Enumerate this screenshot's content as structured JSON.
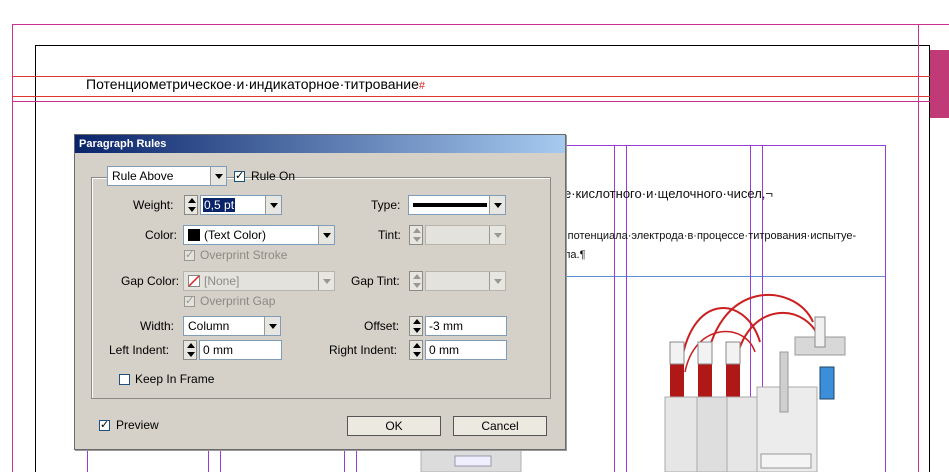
{
  "document": {
    "heading": "Потенциометрическое·и·индикаторное·титрование",
    "heading_mark": "#",
    "text_line1": "е·кислотного·и·щелочного·чисел,¬",
    "text_line2": "·потенциала·электрода·в·процессе·титрования·испытуе-",
    "text_line3": "ла.¶"
  },
  "dialog": {
    "title": "Paragraph Rules",
    "rule_select": "Rule Above",
    "rule_on_label": "Rule On",
    "rule_on_checked": true,
    "weight_label": "Weight:",
    "weight_value": "0,5 pt",
    "type_label": "Type:",
    "color_label": "Color:",
    "color_value": "(Text Color)",
    "tint_label": "Tint:",
    "overprint_stroke_label": "Overprint Stroke",
    "gap_color_label": "Gap Color:",
    "gap_color_value": "[None]",
    "gap_tint_label": "Gap Tint:",
    "overprint_gap_label": "Overprint Gap",
    "width_label": "Width:",
    "width_value": "Column",
    "offset_label": "Offset:",
    "offset_value": "-3 mm",
    "left_indent_label": "Left Indent:",
    "left_indent_value": "0 mm",
    "right_indent_label": "Right Indent:",
    "right_indent_value": "0 mm",
    "keep_in_frame_label": "Keep In Frame",
    "preview_label": "Preview",
    "ok_label": "OK",
    "cancel_label": "Cancel"
  },
  "colors": {
    "margin_guide": "#c8318f",
    "baseline_guide": "#e0352b",
    "column_guide": "#9b3bd6",
    "page_tab": "#c03a78"
  }
}
